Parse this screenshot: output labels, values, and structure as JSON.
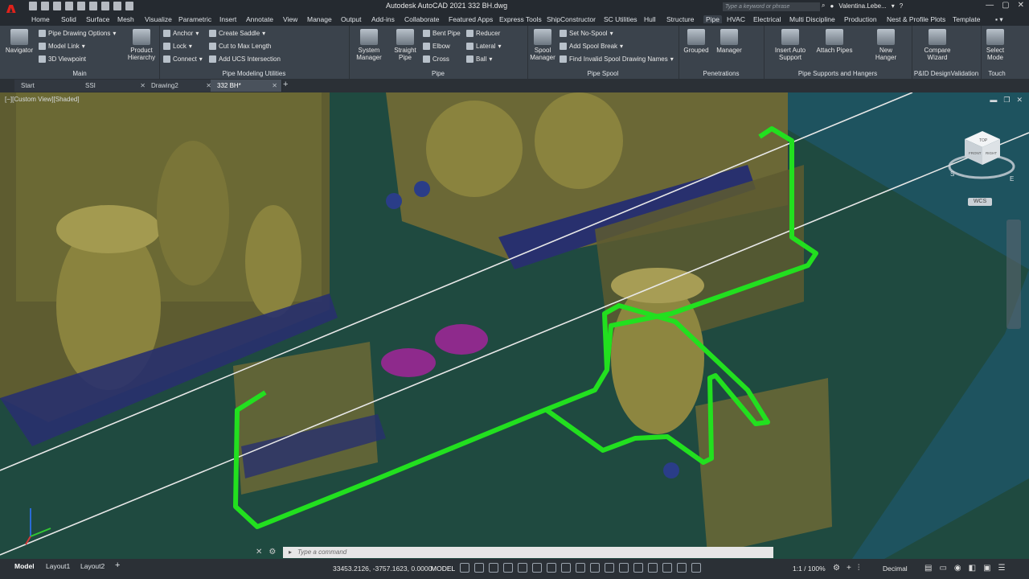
{
  "app": {
    "title": "Autodesk AutoCAD 2021    332 BH.dwg",
    "search_placeholder": "Type a keyword or phrase",
    "user": "Valentina.Lebe...",
    "logo_letter": "A"
  },
  "ribbon_tabs": [
    "Home",
    "Solid",
    "Surface",
    "Mesh",
    "Visualize",
    "Parametric",
    "Insert",
    "Annotate",
    "View",
    "Manage",
    "Output",
    "Add-ins",
    "Collaborate",
    "Featured Apps",
    "Express Tools",
    "ShipConstructor",
    "SC Utilities",
    "Hull",
    "Structure",
    "Pipe",
    "HVAC",
    "Electrical",
    "Multi Discipline",
    "Production",
    "Nest & Profile Plots",
    "Template"
  ],
  "active_tab": "Pipe",
  "panels": {
    "main": {
      "title": "Main",
      "navigator": "Navigator",
      "pipe_drawing_options": "Pipe Drawing Options",
      "model_link": "Model Link",
      "viewpoint_3d": "3D Viewpoint",
      "product_hierarchy": "Product Hierarchy"
    },
    "pipe_modeling_utilities": {
      "title": "Pipe Modeling Utilities",
      "anchor": "Anchor",
      "lock": "Lock",
      "connect": "Connect",
      "create_saddle": "Create Saddle",
      "cut_to_max_length": "Cut to Max Length",
      "add_ucs_intersection": "Add UCS Intersection"
    },
    "pipe": {
      "title": "Pipe",
      "system_manager": "System Manager",
      "straight_pipe": "Straight Pipe",
      "bent_pipe": "Bent Pipe",
      "elbow": "Elbow",
      "cross": "Cross",
      "reducer": "Reducer",
      "lateral": "Lateral",
      "ball": "Ball"
    },
    "pipe_spool": {
      "title": "Pipe Spool",
      "spool_manager": "Spool Manager",
      "set_no_spool": "Set No-Spool",
      "add_spool_break": "Add Spool Break",
      "find_invalid": "Find Invalid Spool Drawing Names"
    },
    "penetrations": {
      "title": "Penetrations",
      "grouped": "Grouped",
      "manager": "Manager"
    },
    "pipe_supports": {
      "title": "Pipe Supports and Hangers",
      "insert_auto_support": "Insert Auto Support",
      "attach_pipes": "Attach Pipes",
      "new_hanger": "New Hanger"
    },
    "pid": {
      "title": "P&ID DesignValidation",
      "compare_wizard": "Compare Wizard"
    },
    "touch": {
      "title": "Touch",
      "select_mode": "Select Mode"
    }
  },
  "doc_tabs": [
    "Start",
    "SSI",
    "Drawing2",
    "332 BH*"
  ],
  "viewport": {
    "label": "[−][Custom View][Shaded]",
    "viewcube_top": "TOP",
    "viewcube_front": "FRONT",
    "viewcube_right": "RIGHT",
    "compass_s": "S",
    "compass_e": "E",
    "wcs": "WCS"
  },
  "command": {
    "placeholder": "Type a command"
  },
  "status": {
    "layout_tabs": [
      "Model",
      "Layout1",
      "Layout2"
    ],
    "coords": "33453.2126, -3757.1623, 0.0000",
    "model": "MODEL",
    "scale": "1:1 / 100%",
    "units": "Decimal"
  },
  "colors": {
    "pipe": "#22e01f",
    "floor": "#1f4a40",
    "equipment": "#7f7a38",
    "ribbon": "#3b434c",
    "accent_red": "#e0221b"
  }
}
